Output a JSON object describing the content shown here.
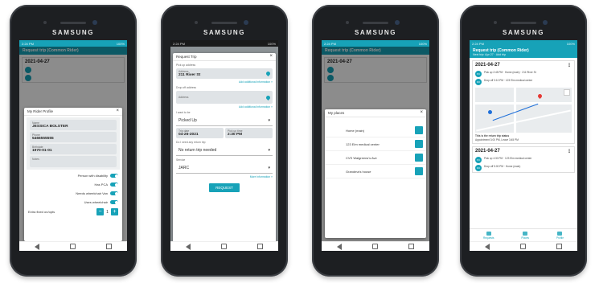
{
  "phone_brand": "SAMSUNG",
  "colors": {
    "accent": "#17a2b8",
    "phone_body": "#1d1f22"
  },
  "phone1": {
    "bg_header_title": "Request trip (Common Rider)",
    "bg_trip_date": "2021-04-27",
    "modal_title": "My Rider Profile",
    "fields": [
      {
        "label": "Name",
        "value": "JESSICA BOLSTER"
      },
      {
        "label": "Phone",
        "value": "5466555555"
      },
      {
        "label": "Birthdate",
        "value": "1970-01-01"
      },
      {
        "label": "Notes",
        "value": ""
      }
    ],
    "toggles": [
      "Person with disability",
      "Has PCA",
      "Needs wheelchair Van",
      "Uses wheelchair"
    ],
    "stepper_label": "Extra fixed on/opts",
    "stepper_value": "1",
    "minus": "−",
    "plus": "+"
  },
  "phone2": {
    "modal_title": "Request Trip",
    "pickup_label": "Pick up address",
    "pickup_sub": "Address",
    "pickup_value": "211 River St",
    "pickup_link": "Add additional information »",
    "dropoff_label": "Drop off address",
    "dropoff_sub": "Address",
    "dropoff_link": "Add additional information »",
    "leave_label": "I want to be",
    "leave_value": "Picked Up",
    "date_label": "Trip date",
    "date_value": "04-26-2021",
    "time_label": "Pick up time",
    "time_value": "2:30 PM",
    "return_label": "Do I need any return trip",
    "return_value": "No return trip needed",
    "service_label": "Service",
    "service_value": "JARC",
    "more_link": "More information »",
    "request_button": "REQUEST"
  },
  "phone3": {
    "bg_header_title": "Request trip (Common Rider)",
    "bg_trip_date": "2021-04-27",
    "modal_title": "My places",
    "places": [
      "Home (main)",
      "123 Elm medical center",
      "CVS Walgreens's Ave",
      "Grandma's house"
    ]
  },
  "phone4": {
    "header_title": "Request trip (Common Rider)",
    "header_sub": "Next trip: Apr 27 · Add trip",
    "trips": [
      {
        "date": "2021-04-27",
        "stops": [
          {
            "badge": "PU",
            "text": "Pick up 2:45 PM · Home (main) · 211 River St"
          },
          {
            "badge": "DO",
            "text": "Drop off 3:10 PM · 123 Elm medical center"
          }
        ],
        "note": "This is the return trip status",
        "appointment": "Appointment 3:00 PM, Leave 3:45 PM"
      },
      {
        "date": "2021-04-27",
        "stops": [
          {
            "badge": "PU",
            "text": "Pick up 4:30 PM · 123 Elm medical center"
          },
          {
            "badge": "DO",
            "text": "Drop off 5:00 PM · Home (main)"
          }
        ]
      }
    ],
    "tabs": [
      "Requests",
      "Places",
      "Profile"
    ]
  },
  "status": {
    "time": "2:24 PM",
    "battery": "100%"
  }
}
